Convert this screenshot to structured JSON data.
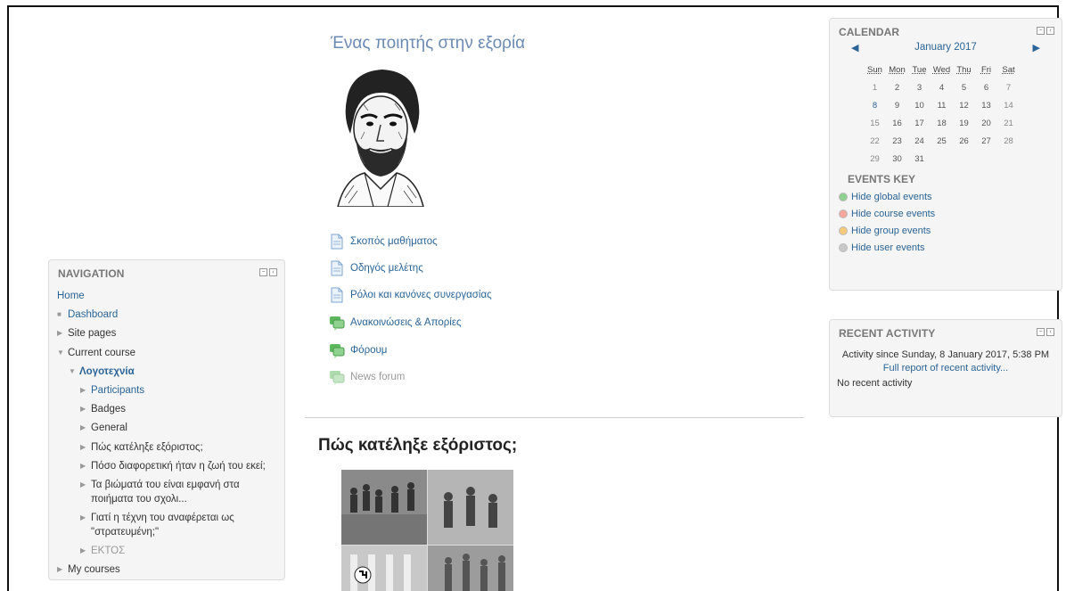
{
  "course": {
    "title": "Ένας ποιητής στην εξορία",
    "activities": [
      {
        "label": "Σκοπός μαθήματος",
        "icon": "page-icon",
        "dim": false
      },
      {
        "label": "Οδηγός μελέτης",
        "icon": "page-icon",
        "dim": false
      },
      {
        "label": "Ρόλοι και κανόνες συνεργασίας",
        "icon": "page-icon",
        "dim": false
      },
      {
        "label": "Ανακοινώσεις & Απορίες",
        "icon": "forum-icon",
        "dim": false
      },
      {
        "label": "Φόρουμ",
        "icon": "forum-icon",
        "dim": false
      },
      {
        "label": "News forum",
        "icon": "forum-icon",
        "dim": true
      }
    ],
    "section_title": "Πώς κατέληξε εξόριστος;"
  },
  "navigation": {
    "title": "NAVIGATION",
    "items": [
      {
        "label": "Home",
        "level": 0,
        "marker": "",
        "link": true,
        "bold": false
      },
      {
        "label": "Dashboard",
        "level": 1,
        "marker": "■",
        "link": true,
        "bold": false
      },
      {
        "label": "Site pages",
        "level": 1,
        "marker": "▶",
        "link": false,
        "bold": false
      },
      {
        "label": "Current course",
        "level": 1,
        "marker": "▼",
        "link": false,
        "bold": false
      },
      {
        "label": "Λογοτεχνία",
        "level": 2,
        "marker": "▼",
        "link": true,
        "bold": true
      },
      {
        "label": "Participants",
        "level": 3,
        "marker": "▶",
        "link": true,
        "bold": false
      },
      {
        "label": "Badges",
        "level": 3,
        "marker": "▶",
        "link": false,
        "bold": false
      },
      {
        "label": "General",
        "level": 3,
        "marker": "▶",
        "link": false,
        "bold": false
      },
      {
        "label": "Πώς κατέληξε εξόριστος;",
        "level": 3,
        "marker": "▶",
        "link": false,
        "bold": false
      },
      {
        "label": "Πόσο διαφορετική ήταν η ζωή του εκεί;",
        "level": 3,
        "marker": "▶",
        "link": false,
        "bold": false
      },
      {
        "label": "Τα βιώματά του είναι εμφανή στα ποιήματα του σχολι...",
        "level": 3,
        "marker": "▶",
        "link": false,
        "bold": false
      },
      {
        "label": "Γιατί η τέχνη του αναφέρεται ως \"στρατευμένη;\"",
        "level": 3,
        "marker": "▶",
        "link": false,
        "bold": false
      },
      {
        "label": "ΕΚΤΟΣ",
        "level": 3,
        "marker": "▶",
        "link": false,
        "bold": false,
        "dim": true
      },
      {
        "label": "My courses",
        "level": 1,
        "marker": "▶",
        "link": false,
        "bold": false
      }
    ]
  },
  "calendar": {
    "title": "CALENDAR",
    "month": "January 2017",
    "weekdays": [
      "Sun",
      "Mon",
      "Tue",
      "Wed",
      "Thu",
      "Fri",
      "Sat"
    ],
    "weeks": [
      [
        "1",
        "2",
        "3",
        "4",
        "5",
        "6",
        "7"
      ],
      [
        "8",
        "9",
        "10",
        "11",
        "12",
        "13",
        "14"
      ],
      [
        "15",
        "16",
        "17",
        "18",
        "19",
        "20",
        "21"
      ],
      [
        "22",
        "23",
        "24",
        "25",
        "26",
        "27",
        "28"
      ],
      [
        "29",
        "30",
        "31",
        "",
        "",
        "",
        ""
      ]
    ],
    "events_key_title": "EVENTS KEY",
    "events": [
      {
        "label": "Hide global events",
        "color": "#8fcf8f"
      },
      {
        "label": "Hide course events",
        "color": "#f4a79a"
      },
      {
        "label": "Hide group events",
        "color": "#f5c97a"
      },
      {
        "label": "Hide user events",
        "color": "#c8c8c8"
      }
    ]
  },
  "recent_activity": {
    "title": "RECENT ACTIVITY",
    "since": "Activity since Sunday, 8 January 2017, 5:38 PM",
    "full_report": "Full report of recent activity...",
    "none": "No recent activity"
  },
  "colors": {
    "link": "#2a6496",
    "title_blue": "#6b8ab3",
    "block_bg": "#f5f5f5"
  }
}
